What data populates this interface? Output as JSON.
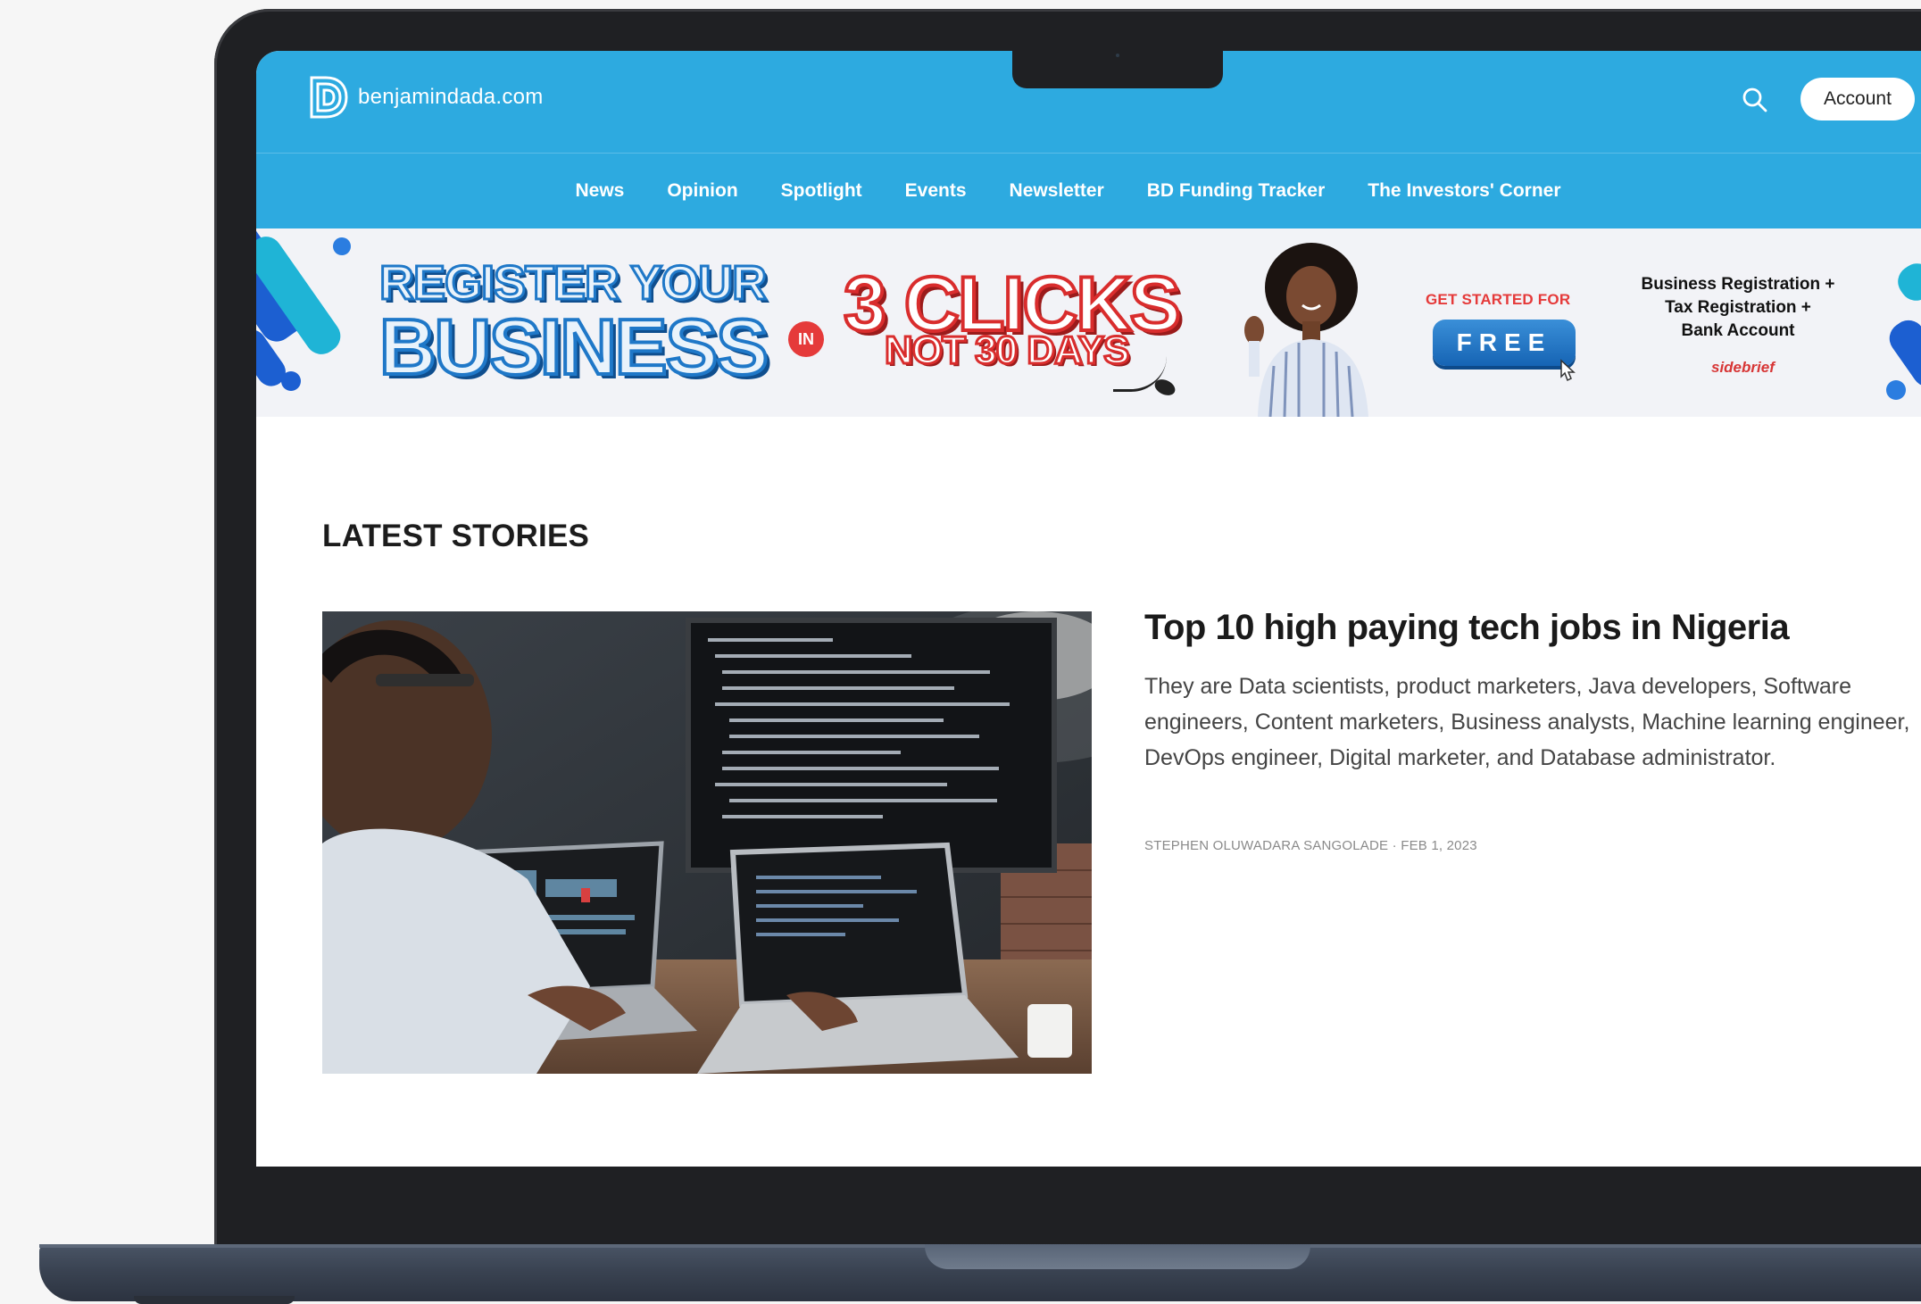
{
  "site": {
    "logo_text": "benjamindada.com",
    "brand_color": "#2daae0"
  },
  "header": {
    "search_icon": "search-icon",
    "account_label": "Account"
  },
  "nav": {
    "items": [
      "News",
      "Opinion",
      "Spotlight",
      "Events",
      "Newsletter",
      "BD Funding Tracker",
      "The Investors' Corner"
    ]
  },
  "banner": {
    "headline_line1": "REGISTER YOUR",
    "headline_line2": "BUSINESS",
    "in_badge": "IN",
    "clicks": "3 CLICKS",
    "not_days": "NOT 30 DAYS",
    "get_started": "GET STARTED FOR",
    "free_label": "FREE",
    "services_line1": "Business Registration +",
    "services_line2": "Tax Registration +",
    "services_line3": "Bank Account",
    "sponsor": "sidebrief"
  },
  "latest": {
    "section_title": "LATEST STORIES",
    "story": {
      "title": "Top 10 high paying tech jobs in Nigeria",
      "excerpt": "They are Data scientists, product marketers, Java developers, Software engineers, Content marketers, Business analysts, Machine learning engineer, DevOps engineer, Digital marketer, and Database administrator.",
      "author": "STEPHEN OLUWADARA SANGOLADE",
      "separator": "·",
      "date": "FEB 1, 2023"
    }
  }
}
